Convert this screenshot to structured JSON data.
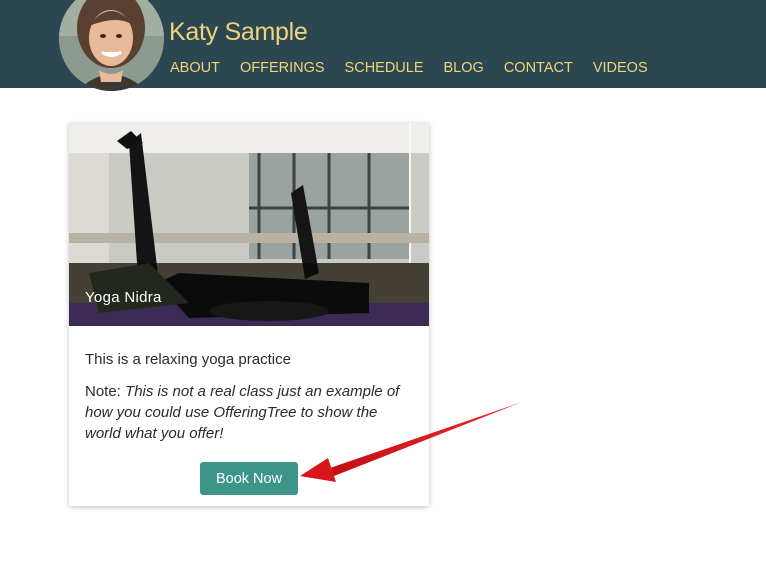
{
  "header": {
    "brand": "Katy Sample",
    "nav": [
      "ABOUT",
      "OFFERINGS",
      "SCHEDULE",
      "BLOG",
      "CONTACT",
      "VIDEOS"
    ]
  },
  "card": {
    "image_title": "Yoga Nidra",
    "description": "This is a relaxing yoga practice",
    "note_label": "Note:",
    "note_text": "This is not a real class just an example of how you could use OfferingTree to show the world what you offer!",
    "button_label": "Book Now"
  },
  "colors": {
    "header_bg": "#2a4752",
    "brand_text": "#f2d27a",
    "button_bg": "#3d9489",
    "annotation_arrow": "#e0141a"
  },
  "icons": {
    "annotation": "red-arrow-icon"
  }
}
